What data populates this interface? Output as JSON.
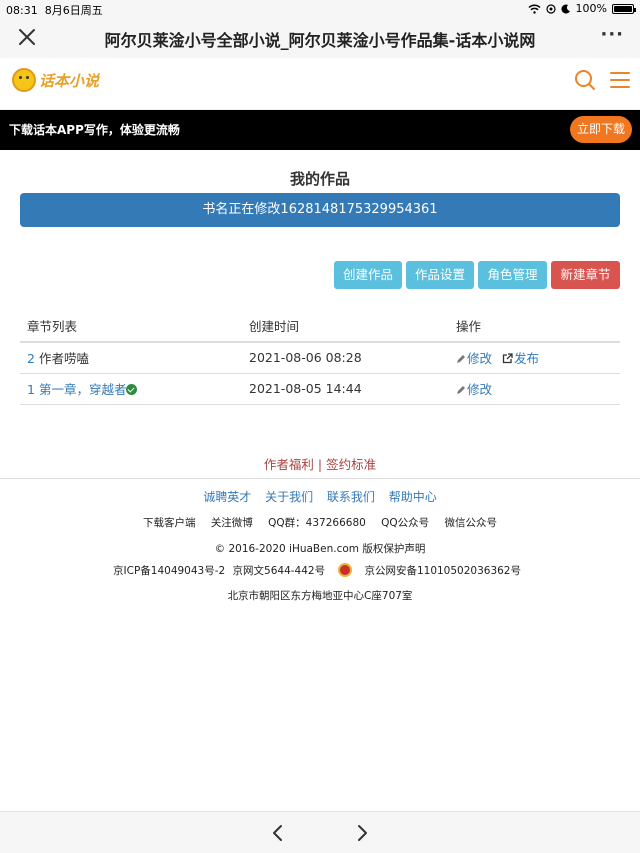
{
  "status": {
    "time": "08:31",
    "date": "8月6日周五",
    "battery": "100%",
    "battery_level": 1.0
  },
  "browser": {
    "title": "阿尔贝莱淦小号全部小说_阿尔贝莱淦小号作品集-话本小说网",
    "more": "···"
  },
  "site": {
    "logo_text": "话本小说"
  },
  "app_banner": {
    "text": "下载话本APP写作，体验更流畅",
    "button": "立即下载"
  },
  "works": {
    "title": "我的作品",
    "notice": "书名正在修改1628148175329954361",
    "buttons": {
      "create_work": "创建作品",
      "work_settings": "作品设置",
      "role_manage": "角色管理",
      "new_chapter": "新建章节"
    }
  },
  "table": {
    "headers": [
      "章节列表",
      "创建时间",
      "操作"
    ],
    "rows": [
      {
        "index": "2",
        "name": "作者唠嗑",
        "time": "2021-08-06 08:28",
        "edit": "修改",
        "publish": "发布"
      },
      {
        "index": "1",
        "name": "第一章，穿越者",
        "time": "2021-08-05 14:44",
        "edit": "修改"
      }
    ]
  },
  "author_links": {
    "welfare": "作者福利",
    "sep": " | ",
    "sign": "签约标准"
  },
  "footer": {
    "links": [
      "诚聘英才",
      "关于我们",
      "联系我们",
      "帮助中心"
    ],
    "info": [
      "下载客户端",
      "关注微博",
      "QQ群：437266680",
      "QQ公众号",
      "微信公众号"
    ],
    "copyright": "© 2016-2020 iHuaBen.com 版权保护声明",
    "icp": "京ICP备14049043号-2",
    "wenwang": "京网文5644-442号",
    "police": "京公网安备11010502036362号",
    "address": "北京市朝阳区东方梅地亚中心C座707室"
  },
  "colors": {
    "primary": "#337ab7",
    "info": "#5bc0de",
    "danger": "#d9534f",
    "accent": "#f07620"
  }
}
